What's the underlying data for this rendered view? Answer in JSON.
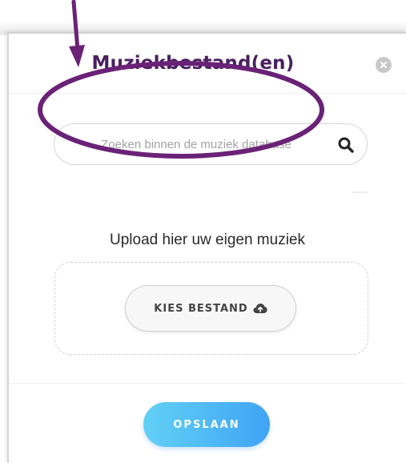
{
  "modal": {
    "title": "Muziekbestand(en)",
    "close_icon": "close-icon"
  },
  "search": {
    "placeholder": "Zoeken binnen de muziek database",
    "value": "",
    "icon": "search-icon"
  },
  "upload": {
    "title": "Upload hier uw eigen muziek",
    "choose_label": "KIES BESTAND",
    "choose_icon": "cloud-upload-icon"
  },
  "footer": {
    "save_label": "OPSLAAN"
  },
  "annotation": {
    "color": "#6a2277",
    "shapes": [
      "arrow-annotation",
      "ellipse-annotation"
    ]
  },
  "colors": {
    "title": "#4a2060",
    "save_gradient_start": "#62d0f5",
    "save_gradient_end": "#3fa4f5"
  }
}
